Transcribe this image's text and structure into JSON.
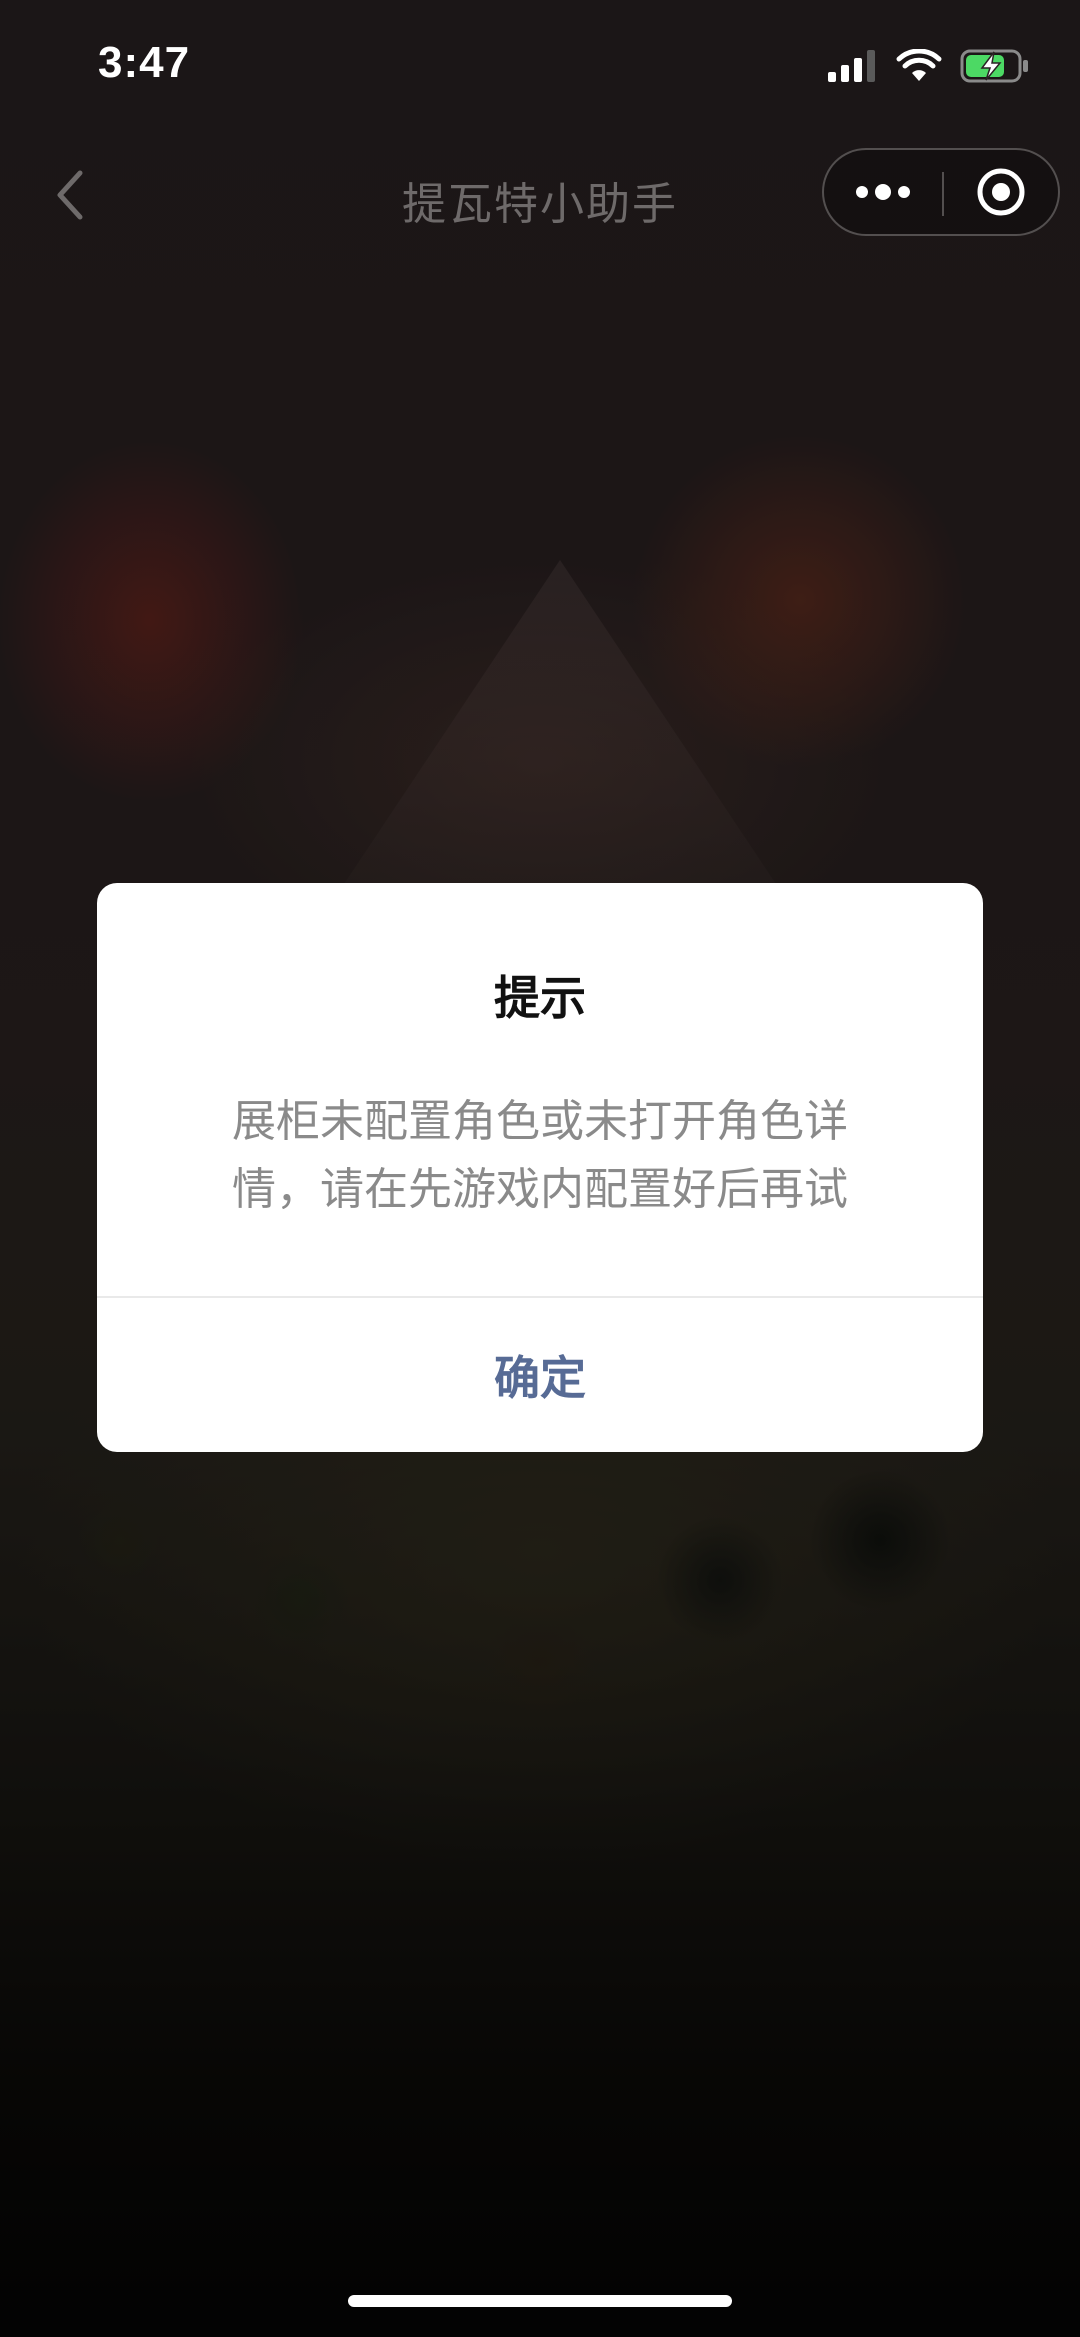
{
  "status_bar": {
    "time": "3:47",
    "icons": [
      "signal-icon",
      "wifi-icon",
      "battery-charging-icon"
    ]
  },
  "nav_bar": {
    "title": "提瓦特小助手",
    "back_icon": "chevron-left-icon",
    "more_icon": "more-dots-icon",
    "close_icon": "target-close-icon"
  },
  "dialog": {
    "title": "提示",
    "content_line1": "展柜未配置角色或未打开角色详",
    "content_line2": "情，请在先游戏内配置好后再试",
    "confirm_label": "确定"
  },
  "colors": {
    "confirm_text": "#576b95",
    "dialog_bg": "#ffffff",
    "content_text": "#8a8a8a"
  }
}
